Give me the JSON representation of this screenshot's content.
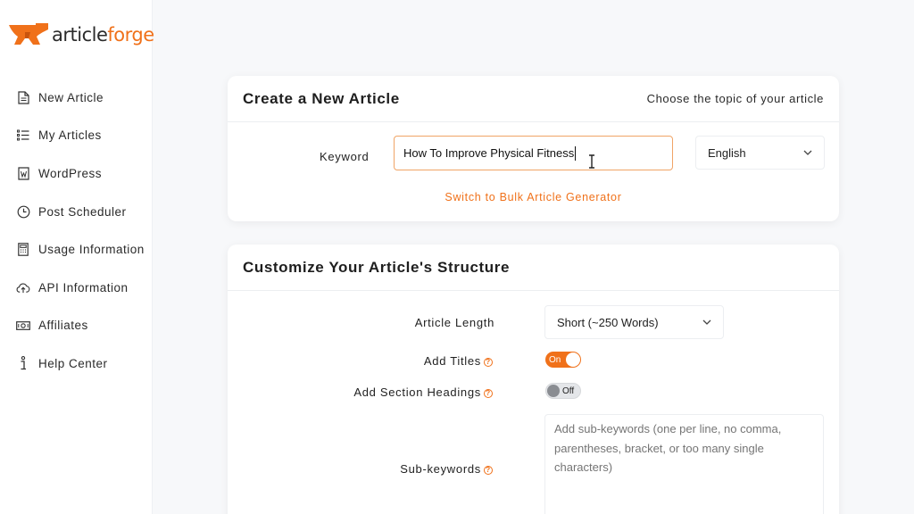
{
  "brand": {
    "logo_text_plain": "article",
    "logo_text_accent": "forge",
    "accent_color": "#f0711a"
  },
  "sidebar": {
    "items": [
      {
        "label": "New Article",
        "icon": "document-icon"
      },
      {
        "label": "My Articles",
        "icon": "list-icon"
      },
      {
        "label": "WordPress",
        "icon": "wordpress-doc-icon"
      },
      {
        "label": "Post Scheduler",
        "icon": "clock-icon"
      },
      {
        "label": "Usage Information",
        "icon": "calculator-icon"
      },
      {
        "label": "API Information",
        "icon": "cloud-upload-icon"
      },
      {
        "label": "Affiliates",
        "icon": "money-icon"
      },
      {
        "label": "Help Center",
        "icon": "info-icon"
      }
    ]
  },
  "create_card": {
    "title": "Create a New Article",
    "subtitle": "Choose the topic of your article",
    "keyword_label": "Keyword",
    "keyword_value": "How To Improve Physical Fitness",
    "language_value": "English",
    "bulk_link": "Switch to Bulk Article Generator"
  },
  "structure_card": {
    "title": "Customize Your Article's Structure",
    "length_label": "Article Length",
    "length_value": "Short (~250 Words)",
    "titles_label": "Add Titles",
    "titles_toggle": "On",
    "headings_label": "Add Section Headings",
    "headings_toggle": "Off",
    "subkeywords_label": "Sub-keywords",
    "subkeywords_placeholder": "Add sub-keywords (one per line, no comma, parentheses, bracket, or too many single characters)"
  }
}
